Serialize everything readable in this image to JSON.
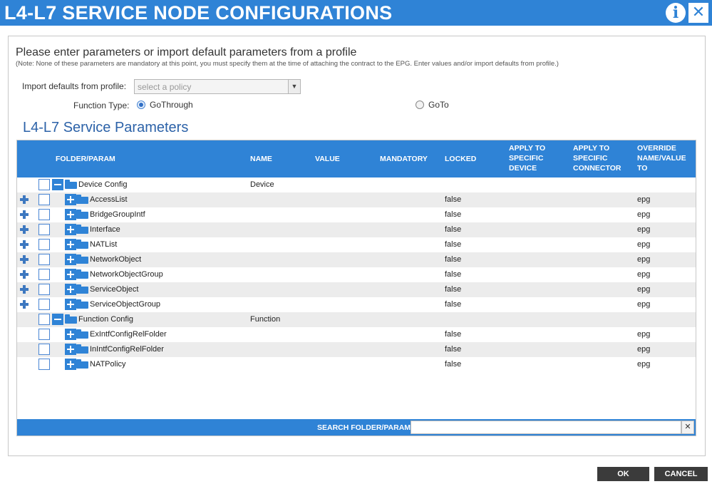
{
  "window": {
    "title": "L4-L7 SERVICE NODE CONFIGURATIONS",
    "info_icon": "i",
    "close_icon": "✕"
  },
  "form": {
    "intro": "Please enter parameters or import default parameters from a profile",
    "note": "(Note: None of these parameters are mandatory at this point, you must specify them at the time of attaching the contract to the EPG. Enter values and/or import defaults from profile.)",
    "import_label": "Import defaults from profile:",
    "import_placeholder": "select a policy",
    "function_type_label": "Function Type:",
    "function_types": [
      {
        "label": "GoThrough",
        "selected": true
      },
      {
        "label": "GoTo",
        "selected": false
      }
    ],
    "section_title": "L4-L7 Service Parameters"
  },
  "table": {
    "columns": {
      "folder_param": "FOLDER/PARAM",
      "name": "NAME",
      "value": "VALUE",
      "mandatory": "MANDATORY",
      "locked": "LOCKED",
      "apply_device_1": "APPLY TO",
      "apply_device_2": "SPECIFIC",
      "apply_device_3": "DEVICE",
      "apply_connector_1": "APPLY TO",
      "apply_connector_2": "SPECIFIC",
      "apply_connector_3": "CONNECTOR",
      "override_1": "OVERRIDE",
      "override_2": "NAME/VALUE",
      "override_3": "TO"
    },
    "rows": [
      {
        "label": "Device Config",
        "name": "Device",
        "locked": "",
        "override": ""
      },
      {
        "label": "AccessList",
        "name": "",
        "locked": "false",
        "override": "epg"
      },
      {
        "label": "BridgeGroupIntf",
        "name": "",
        "locked": "false",
        "override": "epg"
      },
      {
        "label": "Interface",
        "name": "",
        "locked": "false",
        "override": "epg"
      },
      {
        "label": "NATList",
        "name": "",
        "locked": "false",
        "override": "epg"
      },
      {
        "label": "NetworkObject",
        "name": "",
        "locked": "false",
        "override": "epg"
      },
      {
        "label": "NetworkObjectGroup",
        "name": "",
        "locked": "false",
        "override": "epg"
      },
      {
        "label": "ServiceObject",
        "name": "",
        "locked": "false",
        "override": "epg"
      },
      {
        "label": "ServiceObjectGroup",
        "name": "",
        "locked": "false",
        "override": "epg"
      },
      {
        "label": "Function Config",
        "name": "Function",
        "locked": "",
        "override": ""
      },
      {
        "label": "ExIntfConfigRelFolder",
        "name": "",
        "locked": "false",
        "override": "epg"
      },
      {
        "label": "InIntfConfigRelFolder",
        "name": "",
        "locked": "false",
        "override": "epg"
      },
      {
        "label": "NATPolicy",
        "name": "",
        "locked": "false",
        "override": "epg"
      }
    ],
    "search_label": "SEARCH FOLDER/PARAM:",
    "search_value": "",
    "search_clear": "✕"
  },
  "footer": {
    "ok": "OK",
    "cancel": "CANCEL"
  }
}
